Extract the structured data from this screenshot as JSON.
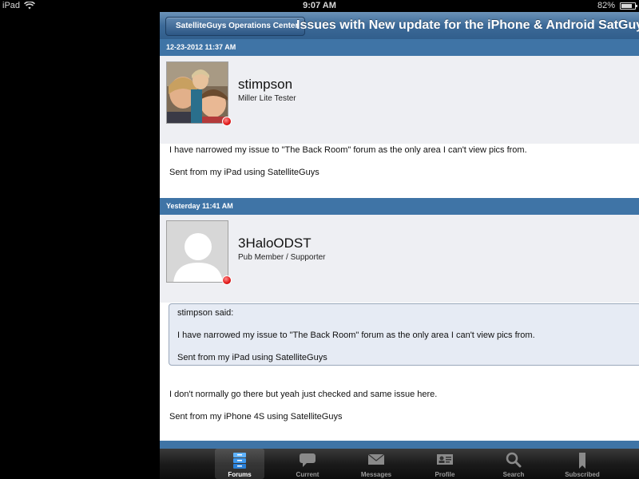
{
  "status_bar": {
    "device": "iPad",
    "time": "9:07 AM",
    "battery": "82%",
    "battery_level": 0.82
  },
  "nav": {
    "back_label": "SatelliteGuys Operations Center",
    "title": "Issues with New update for the iPhone & Android SatGuys"
  },
  "posts": [
    {
      "date": "12-23-2012 11:37 AM",
      "username": "stimpson",
      "user_title": "Miller Lite Tester",
      "online_status": "offline",
      "body": [
        "I have narrowed my issue to \"The Back Room\" forum as the only area I can't view pics from.",
        "Sent from my iPad using SatelliteGuys"
      ]
    },
    {
      "date": "Yesterday 11:41 AM",
      "username": "3HaloODST",
      "user_title": "Pub Member / Supporter",
      "online_status": "offline",
      "quote": {
        "author_line": "stimpson said:",
        "lines": [
          "I have narrowed my issue to \"The Back Room\" forum as the only area I can't view pics from.",
          "Sent from my iPad using SatelliteGuys"
        ]
      },
      "body": [
        "I don't normally go there but yeah just checked and same issue here.",
        "Sent from my iPhone 4S using SatelliteGuys"
      ]
    }
  ],
  "tabs": [
    {
      "label": "Forums",
      "icon": "forums-icon",
      "active": true
    },
    {
      "label": "Current",
      "icon": "speech-bubble-icon",
      "active": false
    },
    {
      "label": "Messages",
      "icon": "envelope-icon",
      "active": false
    },
    {
      "label": "Profile",
      "icon": "profile-card-icon",
      "active": false
    },
    {
      "label": "Search",
      "icon": "magnifier-icon",
      "active": false
    },
    {
      "label": "Subscribed",
      "icon": "bookmark-icon",
      "active": false
    }
  ]
}
